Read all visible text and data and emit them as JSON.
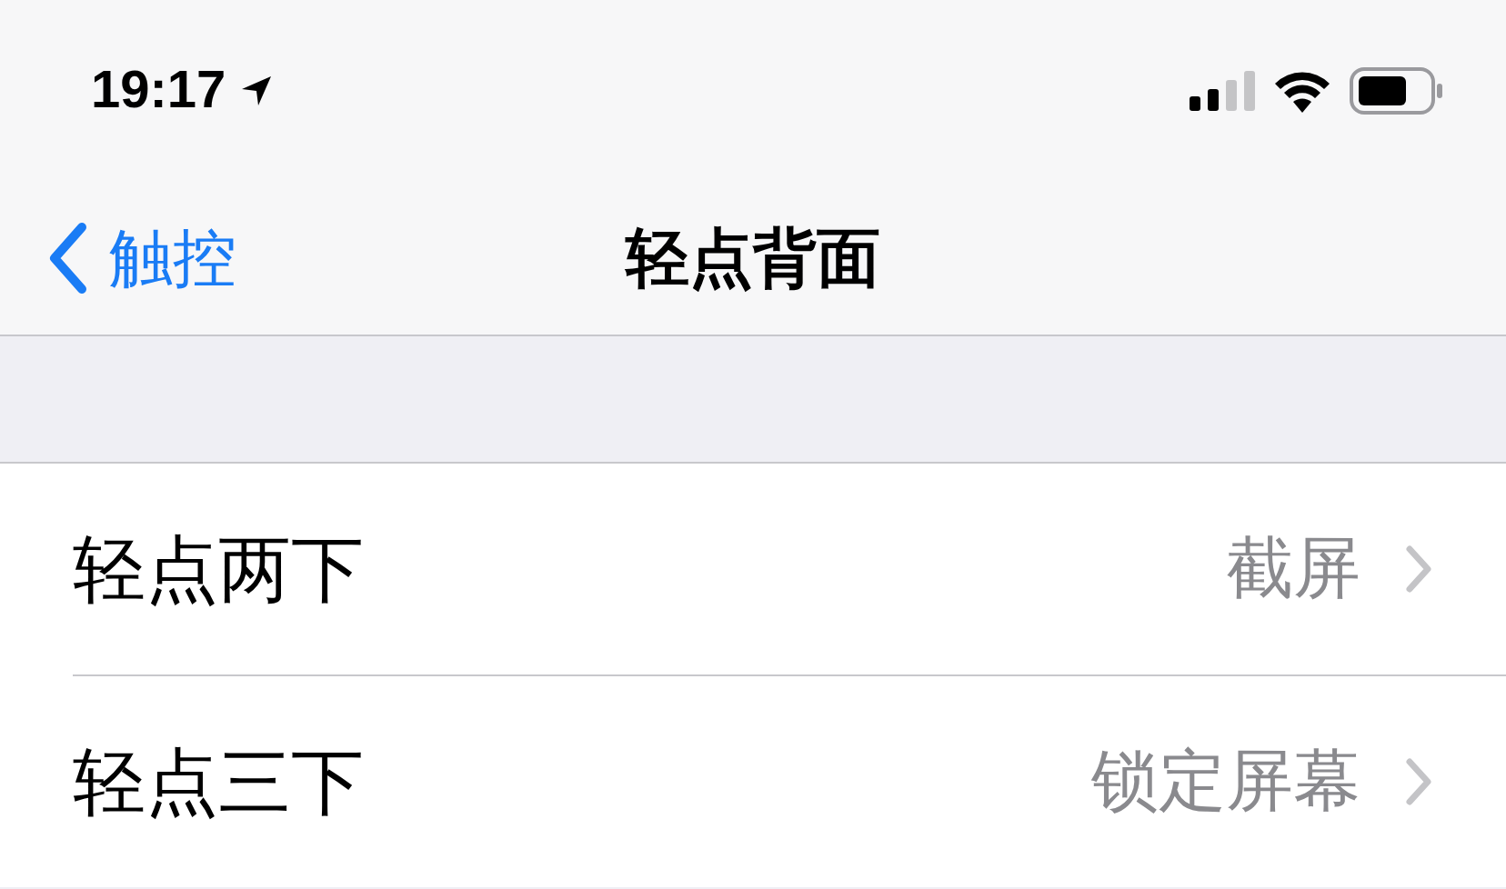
{
  "status_bar": {
    "time": "19:17"
  },
  "nav": {
    "back": "触控",
    "title": "轻点背面"
  },
  "rows": [
    {
      "label": "轻点两下",
      "value": "截屏"
    },
    {
      "label": "轻点三下",
      "value": "锁定屏幕"
    }
  ]
}
